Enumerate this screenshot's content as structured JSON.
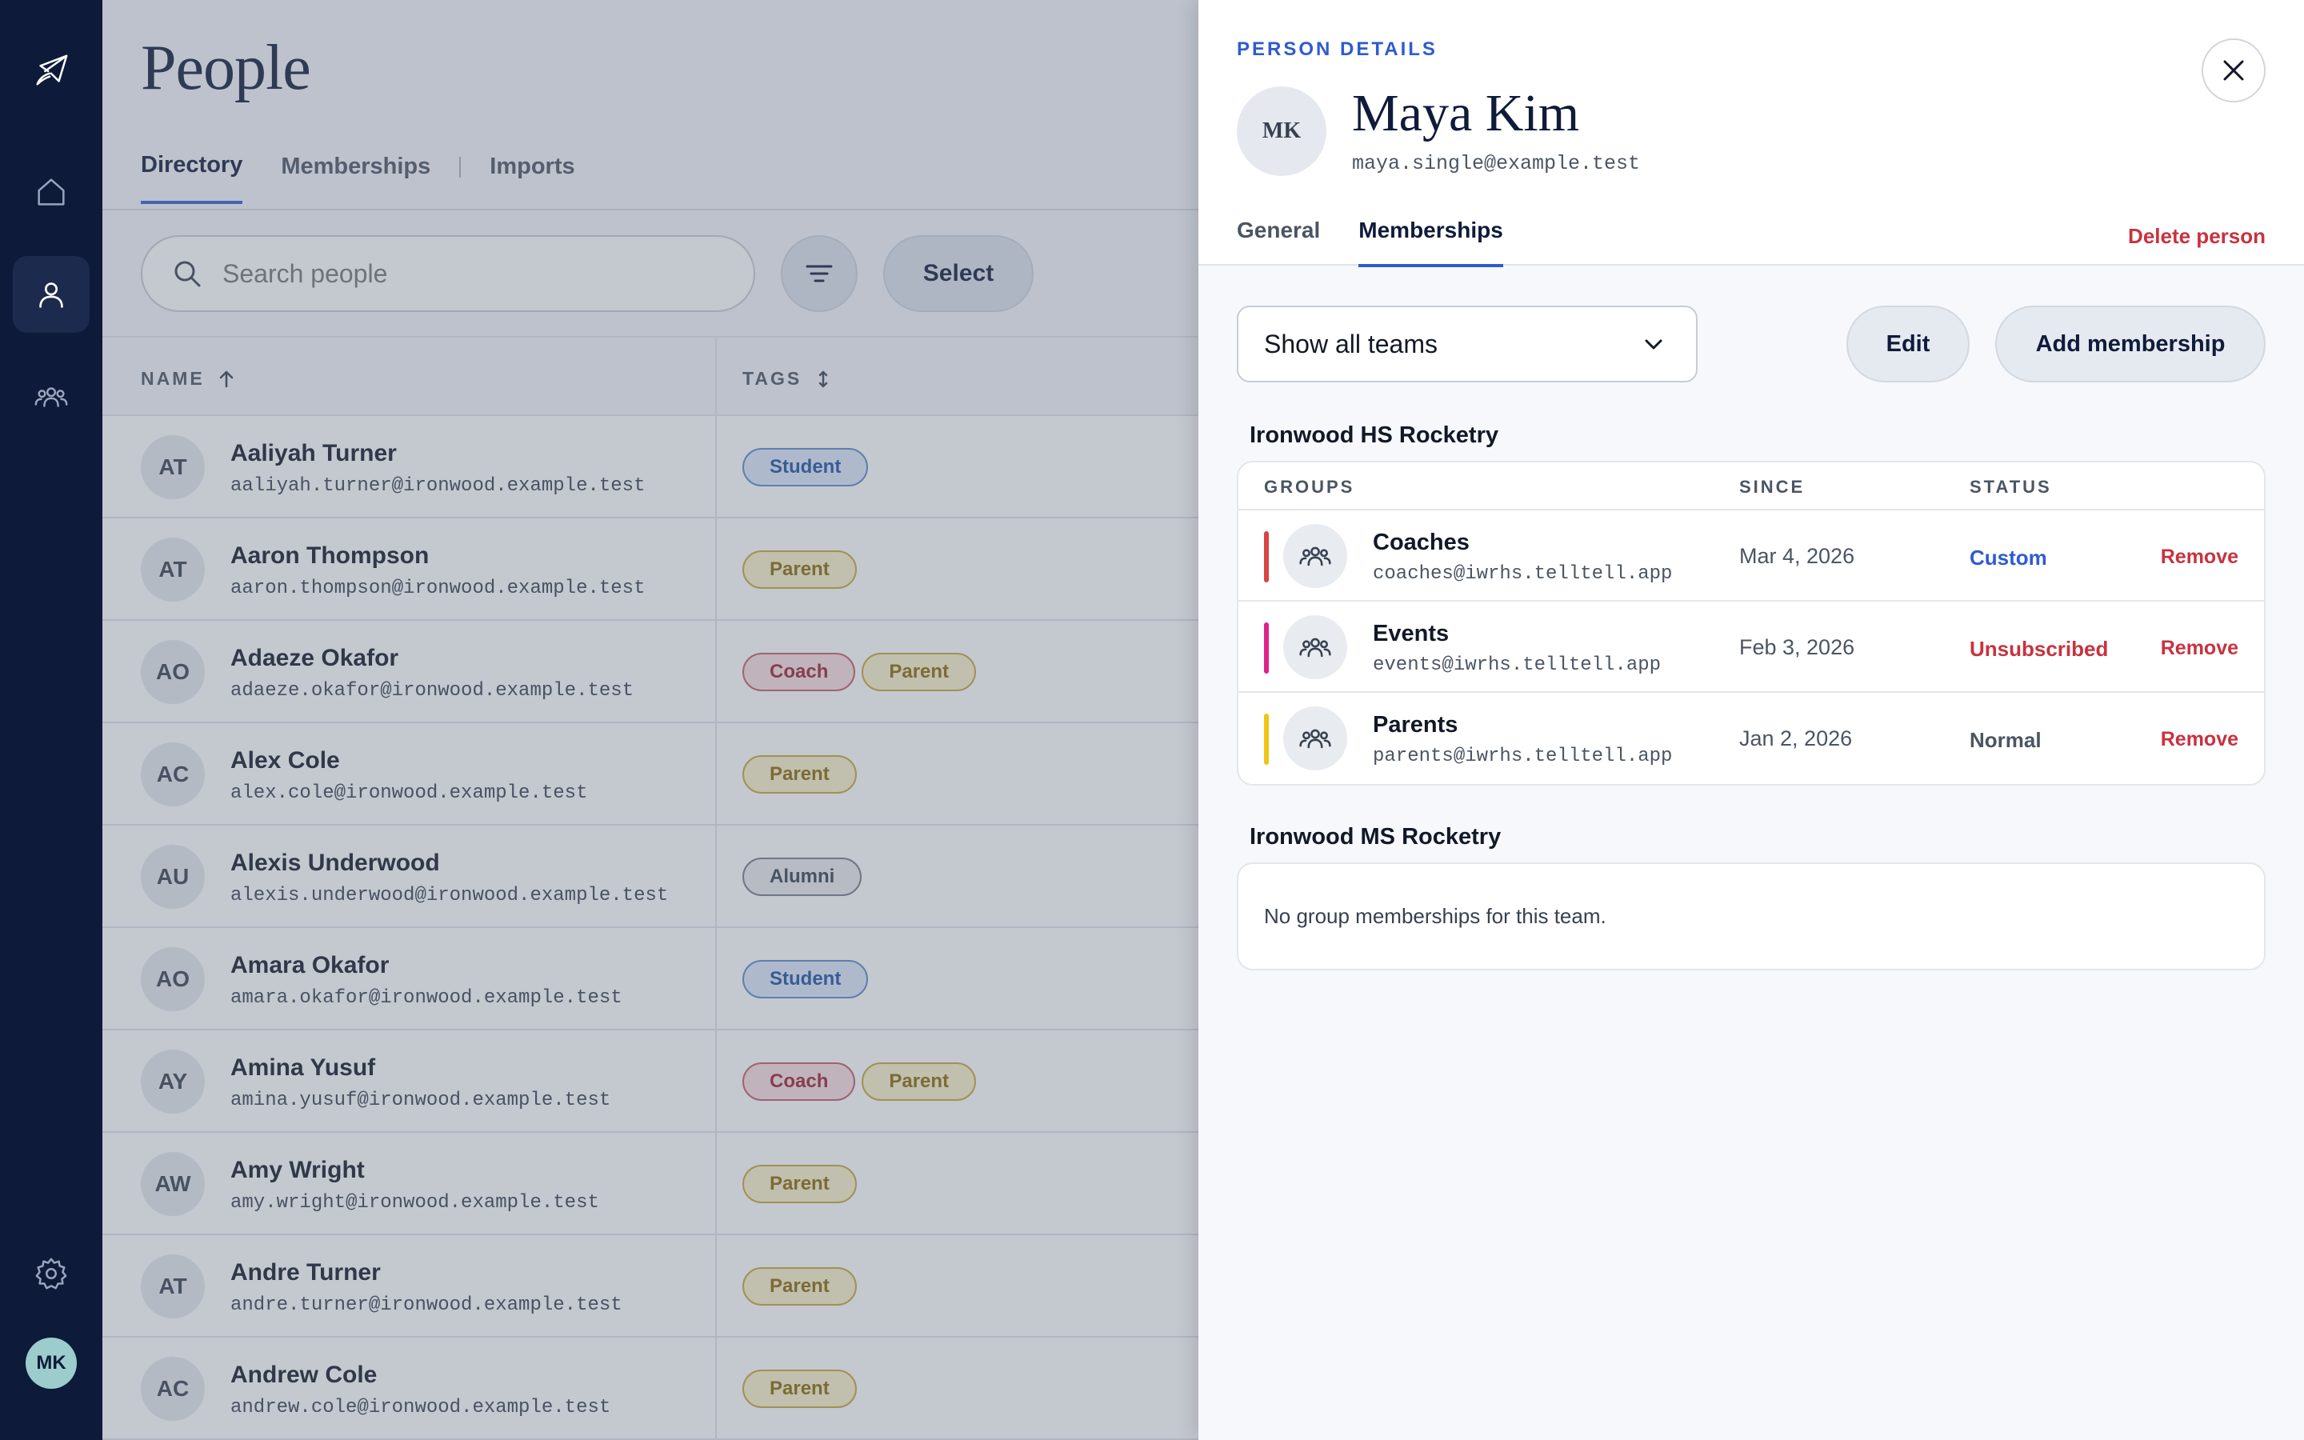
{
  "app": {
    "rail": {
      "items": [
        "home-icon",
        "person-icon",
        "group-icon"
      ],
      "active": "person-icon",
      "settings_icon": "gear-icon",
      "user_initials": "MK"
    }
  },
  "main": {
    "title": "People",
    "tabs": [
      {
        "label": "Directory",
        "active": true
      },
      {
        "label": "Memberships",
        "active": false
      },
      {
        "label": "Imports",
        "active": false
      }
    ],
    "search_placeholder": "Search people",
    "select_label": "Select",
    "columns": {
      "name": "NAME",
      "tags": "TAGS"
    },
    "people": [
      {
        "initials": "AT",
        "name": "Aaliyah Turner",
        "email": "aaliyah.turner@ironwood.example.test",
        "tags": [
          "Student"
        ]
      },
      {
        "initials": "AT",
        "name": "Aaron Thompson",
        "email": "aaron.thompson@ironwood.example.test",
        "tags": [
          "Parent"
        ]
      },
      {
        "initials": "AO",
        "name": "Adaeze Okafor",
        "email": "adaeze.okafor@ironwood.example.test",
        "tags": [
          "Coach",
          "Parent"
        ]
      },
      {
        "initials": "AC",
        "name": "Alex Cole",
        "email": "alex.cole@ironwood.example.test",
        "tags": [
          "Parent"
        ]
      },
      {
        "initials": "AU",
        "name": "Alexis Underwood",
        "email": "alexis.underwood@ironwood.example.test",
        "tags": [
          "Alumni"
        ]
      },
      {
        "initials": "AO",
        "name": "Amara Okafor",
        "email": "amara.okafor@ironwood.example.test",
        "tags": [
          "Student"
        ]
      },
      {
        "initials": "AY",
        "name": "Amina Yusuf",
        "email": "amina.yusuf@ironwood.example.test",
        "tags": [
          "Coach",
          "Parent"
        ]
      },
      {
        "initials": "AW",
        "name": "Amy Wright",
        "email": "amy.wright@ironwood.example.test",
        "tags": [
          "Parent"
        ]
      },
      {
        "initials": "AT",
        "name": "Andre Turner",
        "email": "andre.turner@ironwood.example.test",
        "tags": [
          "Parent"
        ]
      },
      {
        "initials": "AC",
        "name": "Andrew Cole",
        "email": "andrew.cole@ironwood.example.test",
        "tags": [
          "Parent"
        ]
      }
    ]
  },
  "drawer": {
    "eyebrow": "PERSON DETAILS",
    "person": {
      "initials": "MK",
      "name": "Maya Kim",
      "email": "maya.single@example.test"
    },
    "tabs": [
      {
        "label": "General",
        "active": false
      },
      {
        "label": "Memberships",
        "active": true
      }
    ],
    "delete_label": "Delete person",
    "team_filter": "Show all teams",
    "edit_label": "Edit",
    "add_label": "Add membership",
    "group_columns": {
      "groups": "GROUPS",
      "since": "SINCE",
      "status": "STATUS"
    },
    "teams": [
      {
        "name": "Ironwood HS Rocketry",
        "groups": [
          {
            "name": "Coaches",
            "email": "coaches@iwrhs.telltell.app",
            "since": "Mar 4, 2026",
            "status": "Custom",
            "status_color": "#2f5bd0",
            "bar_color": "#d64545",
            "remove": "Remove"
          },
          {
            "name": "Events",
            "email": "events@iwrhs.telltell.app",
            "since": "Feb 3, 2026",
            "status": "Unsubscribed",
            "status_color": "#c8323f",
            "bar_color": "#e0218a",
            "remove": "Remove"
          },
          {
            "name": "Parents",
            "email": "parents@iwrhs.telltell.app",
            "since": "Jan 2, 2026",
            "status": "Normal",
            "status_color": "#4b5563",
            "bar_color": "#f2c414",
            "remove": "Remove"
          }
        ]
      },
      {
        "name": "Ironwood MS Rocketry",
        "empty_message": "No group memberships for this team."
      }
    ]
  },
  "colors": {
    "accent": "#2f5bd0",
    "danger": "#c8323f",
    "rail": "#0d1a3a"
  }
}
